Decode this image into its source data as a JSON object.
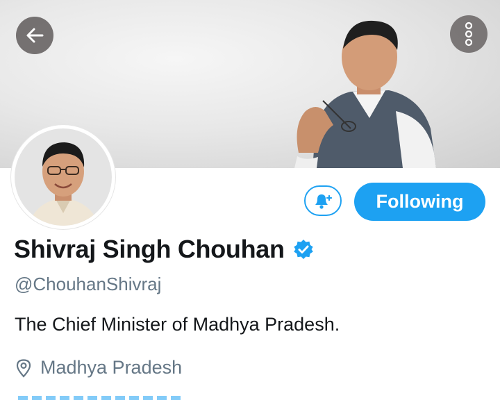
{
  "header": {
    "back_icon": "arrow-left-icon",
    "more_icon": "more-vertical-icon"
  },
  "profile": {
    "display_name": "Shivraj Singh Chouhan",
    "handle": "@ChouhanShivraj",
    "bio": "The Chief Minister of Madhya Pradesh.",
    "location": "Madhya Pradesh",
    "verified_icon": "verified-badge-icon",
    "location_icon": "location-pin-icon"
  },
  "actions": {
    "notify_icon": "bell-plus-icon",
    "following_label": "Following"
  },
  "colors": {
    "accent": "#1da1f2",
    "text_primary": "#14171a",
    "text_secondary": "#657786"
  }
}
